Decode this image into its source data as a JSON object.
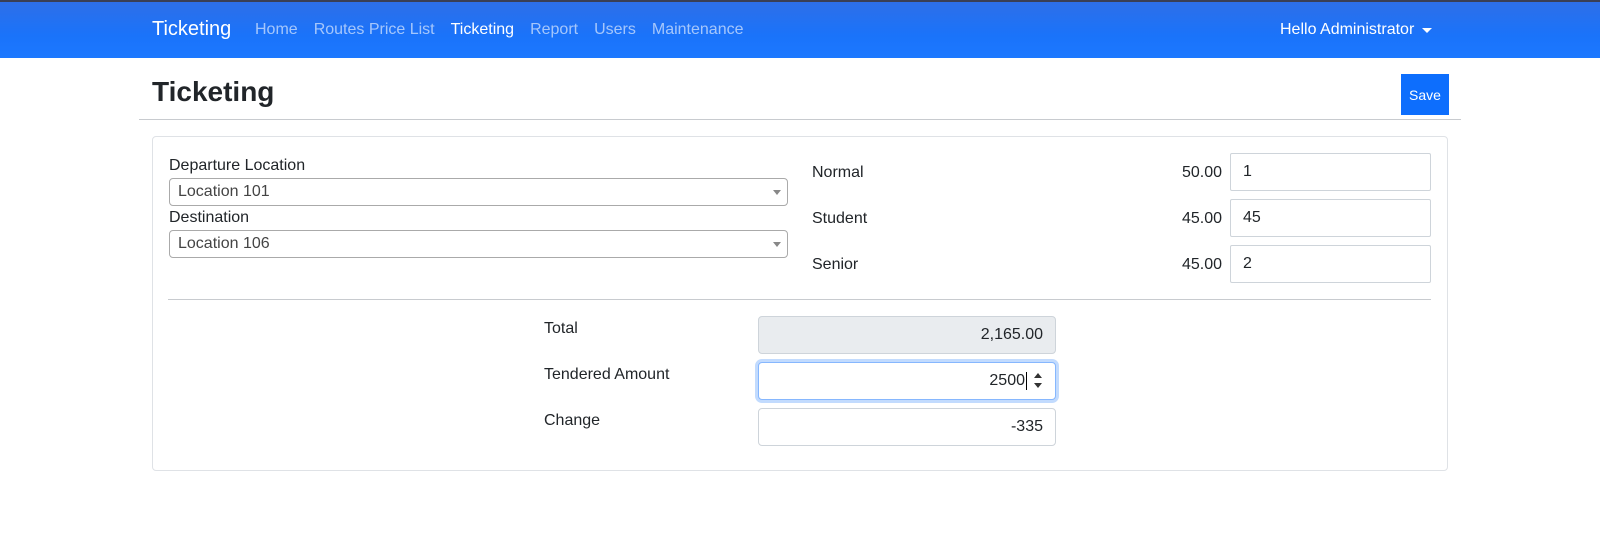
{
  "navbar": {
    "brand": "Ticketing",
    "links": [
      {
        "label": "Home"
      },
      {
        "label": "Routes Price List"
      },
      {
        "label": "Ticketing"
      },
      {
        "label": "Report"
      },
      {
        "label": "Users"
      },
      {
        "label": "Maintenance"
      }
    ],
    "active_link": "Ticketing",
    "user_menu": "Hello Administrator"
  },
  "page": {
    "title": "Ticketing",
    "save_label": "Save"
  },
  "route": {
    "departure_label": "Departure Location",
    "departure_value": "Location 101",
    "destination_label": "Destination",
    "destination_value": "Location 106"
  },
  "fares": [
    {
      "type": "Normal",
      "price": "50.00",
      "quantity": "1"
    },
    {
      "type": "Student",
      "price": "45.00",
      "quantity": "45"
    },
    {
      "type": "Senior",
      "price": "45.00",
      "quantity": "2"
    }
  ],
  "payment": {
    "total_label": "Total",
    "total_value": "2,165.00",
    "tendered_label": "Tendered Amount",
    "tendered_value": "2500",
    "change_label": "Change",
    "change_value": "-335"
  },
  "colors": {
    "navbar": "#1a73fa",
    "primary_button": "#0d6efd",
    "readonly_bg": "#e9ecef",
    "focus_ring": "#86b7fe"
  }
}
